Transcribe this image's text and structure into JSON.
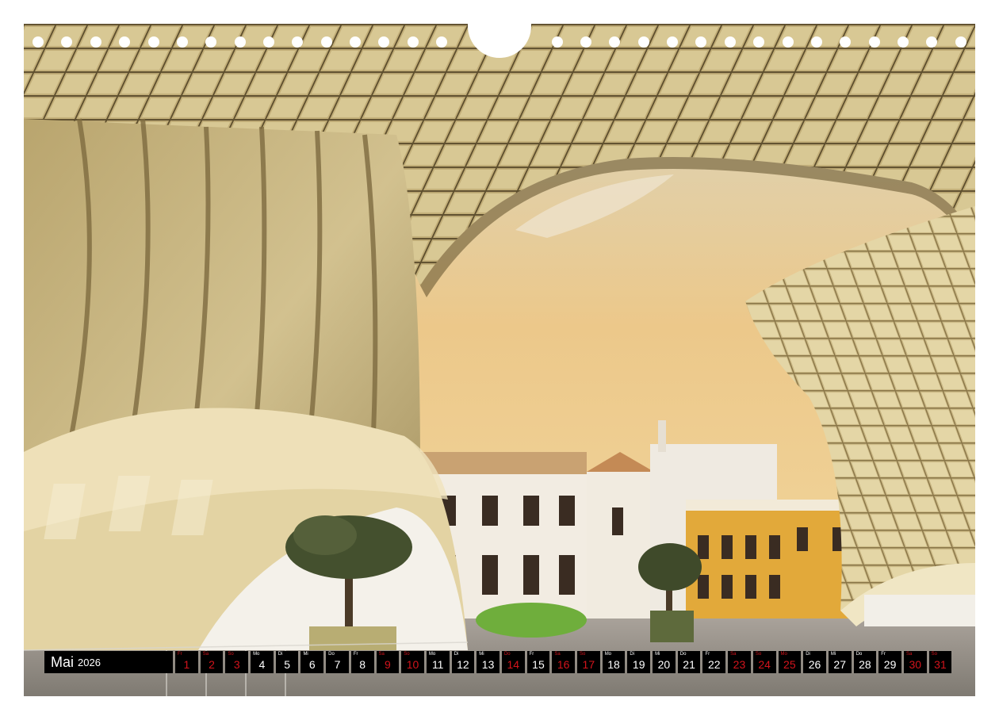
{
  "calendar": {
    "month": "Mai",
    "year": "2026",
    "days": [
      {
        "wd": "Fr",
        "day": "1",
        "weekend": true
      },
      {
        "wd": "Sa",
        "day": "2",
        "weekend": true
      },
      {
        "wd": "So",
        "day": "3",
        "weekend": true
      },
      {
        "wd": "Mo",
        "day": "4",
        "weekend": false
      },
      {
        "wd": "Di",
        "day": "5",
        "weekend": false
      },
      {
        "wd": "Mi",
        "day": "6",
        "weekend": false
      },
      {
        "wd": "Do",
        "day": "7",
        "weekend": false
      },
      {
        "wd": "Fr",
        "day": "8",
        "weekend": false
      },
      {
        "wd": "Sa",
        "day": "9",
        "weekend": true
      },
      {
        "wd": "So",
        "day": "10",
        "weekend": true
      },
      {
        "wd": "Mo",
        "day": "11",
        "weekend": false
      },
      {
        "wd": "Di",
        "day": "12",
        "weekend": false
      },
      {
        "wd": "Mi",
        "day": "13",
        "weekend": false
      },
      {
        "wd": "Do",
        "day": "14",
        "weekend": true
      },
      {
        "wd": "Fr",
        "day": "15",
        "weekend": false
      },
      {
        "wd": "Sa",
        "day": "16",
        "weekend": true
      },
      {
        "wd": "So",
        "day": "17",
        "weekend": true
      },
      {
        "wd": "Mo",
        "day": "18",
        "weekend": false
      },
      {
        "wd": "Di",
        "day": "19",
        "weekend": false
      },
      {
        "wd": "Mi",
        "day": "20",
        "weekend": false
      },
      {
        "wd": "Do",
        "day": "21",
        "weekend": false
      },
      {
        "wd": "Fr",
        "day": "22",
        "weekend": false
      },
      {
        "wd": "Sa",
        "day": "23",
        "weekend": true
      },
      {
        "wd": "So",
        "day": "24",
        "weekend": true
      },
      {
        "wd": "Mo",
        "day": "25",
        "weekend": true
      },
      {
        "wd": "Di",
        "day": "26",
        "weekend": false
      },
      {
        "wd": "Mi",
        "day": "27",
        "weekend": false
      },
      {
        "wd": "Do",
        "day": "28",
        "weekend": false
      },
      {
        "wd": "Fr",
        "day": "29",
        "weekend": false
      },
      {
        "wd": "Sa",
        "day": "30",
        "weekend": true
      },
      {
        "wd": "So",
        "day": "31",
        "weekend": true
      }
    ]
  },
  "colors": {
    "weekend_text": "#d4141c",
    "bar_background": "#000000",
    "sky_top": "#d9d8c4",
    "sky_bottom": "#f0b968",
    "structure": "#c9b98a",
    "building_yellow": "#e2a93a"
  }
}
